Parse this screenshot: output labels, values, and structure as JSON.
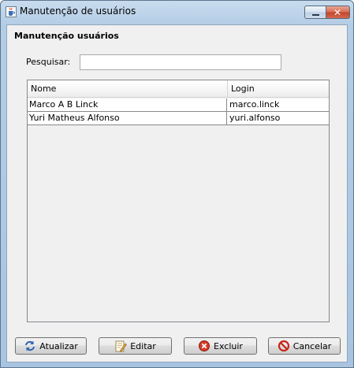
{
  "window": {
    "title": "Manutenção de usuários",
    "icon": "java-cup-icon"
  },
  "form": {
    "section_title": "Manutenção usuários",
    "search_label": "Pesquisar:",
    "search_value": "",
    "search_placeholder": ""
  },
  "table": {
    "columns": [
      "Nome",
      "Login"
    ],
    "rows": [
      {
        "name": "Marco A B Linck",
        "login": "marco.linck"
      },
      {
        "name": "Yuri Matheus Alfonso",
        "login": "yuri.alfonso"
      }
    ]
  },
  "buttons": {
    "refresh": {
      "label": "Atualizar",
      "icon": "refresh-icon"
    },
    "edit": {
      "label": "Editar",
      "icon": "edit-icon"
    },
    "delete": {
      "label": "Excluir",
      "icon": "delete-icon"
    },
    "cancel": {
      "label": "Cancelar",
      "icon": "cancel-icon"
    }
  },
  "colors": {
    "title_bar": "#b4cde6",
    "panel": "#f0f0f0",
    "close_button": "#c4432a"
  }
}
